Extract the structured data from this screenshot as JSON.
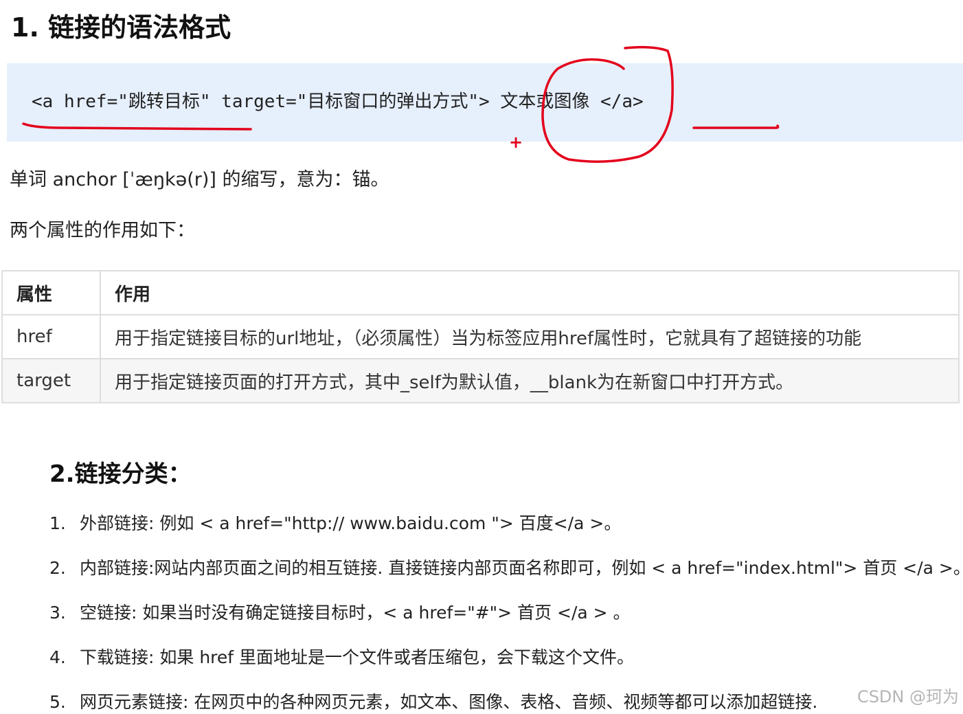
{
  "section1": {
    "title": "1. 链接的语法格式",
    "code": "<a href=\"跳转目标\" target=\"目标窗口的弹出方式\"> 文本或图像 </a>",
    "para1": "单词 anchor [ˈæŋkə(r)] 的缩写，意为：锚。",
    "para2": "两个属性的作用如下：",
    "annotation_plus": "+",
    "table": {
      "headers": [
        "属性",
        "作用"
      ],
      "rows": [
        [
          "href",
          "用于指定链接目标的url地址，（必须属性）当为标签应用href属性时，它就具有了超链接的功能"
        ],
        [
          "target",
          "用于指定链接页面的打开方式，其中_self为默认值，__blank为在新窗口中打开方式。"
        ]
      ]
    }
  },
  "section2": {
    "title": "2.链接分类：",
    "items": [
      {
        "num": "1.",
        "text": "外部链接: 例如 < a href=\"http:// www.baidu.com \"> 百度</a >。"
      },
      {
        "num": "2.",
        "text": "内部链接:网站内部页面之间的相互链接. 直接链接内部页面名称即可，例如 < a href=\"index.html\"> 首页 </a >。"
      },
      {
        "num": "3.",
        "text": "空链接: 如果当时没有确定链接目标时，< a href=\"#\"> 首页 </a > 。"
      },
      {
        "num": "4.",
        "text": "下载链接: 如果 href 里面地址是一个文件或者压缩包，会下载这个文件。"
      },
      {
        "num": "5.",
        "text": "网页元素链接: 在网页中的各种网页元素，如文本、图像、表格、音频、视频等都可以添加超链接."
      }
    ]
  },
  "watermark": "CSDN @珂为",
  "colors": {
    "code_bg": "#e6effc",
    "annotation": "#e3001b",
    "table_border": "#dddddd",
    "row_alt": "#f6f6f6"
  }
}
